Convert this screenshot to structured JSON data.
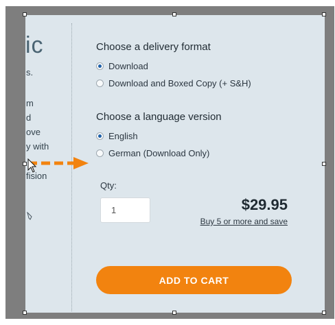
{
  "left_column": {
    "title": "ic",
    "lines": [
      "s.",
      "m",
      "d",
      "ove",
      "y with",
      "fision"
    ]
  },
  "delivery": {
    "heading": "Choose a delivery format",
    "options": [
      {
        "label": "Download",
        "checked": true
      },
      {
        "label": "Download and Boxed Copy (+ S&H)",
        "checked": false
      }
    ]
  },
  "language": {
    "heading": "Choose a language version",
    "options": [
      {
        "label": "English",
        "checked": true
      },
      {
        "label": "German (Download Only)",
        "checked": false
      }
    ]
  },
  "purchase": {
    "qty_label": "Qty:",
    "qty_value": "1",
    "price": "$29.95",
    "bulk_link": "Buy 5 or more and save",
    "cart_button": "ADD TO CART"
  },
  "colors": {
    "accent": "#f2830f",
    "panel_bg": "#dde6ec",
    "frame_bg": "#7e7e7e",
    "radio_selected": "#1c5fa8"
  },
  "icons": {
    "drag_arrow": "dashed-arrow-right-icon",
    "cursor": "mouse-cursor-icon",
    "resize_handle": "resize-handle-icon"
  }
}
